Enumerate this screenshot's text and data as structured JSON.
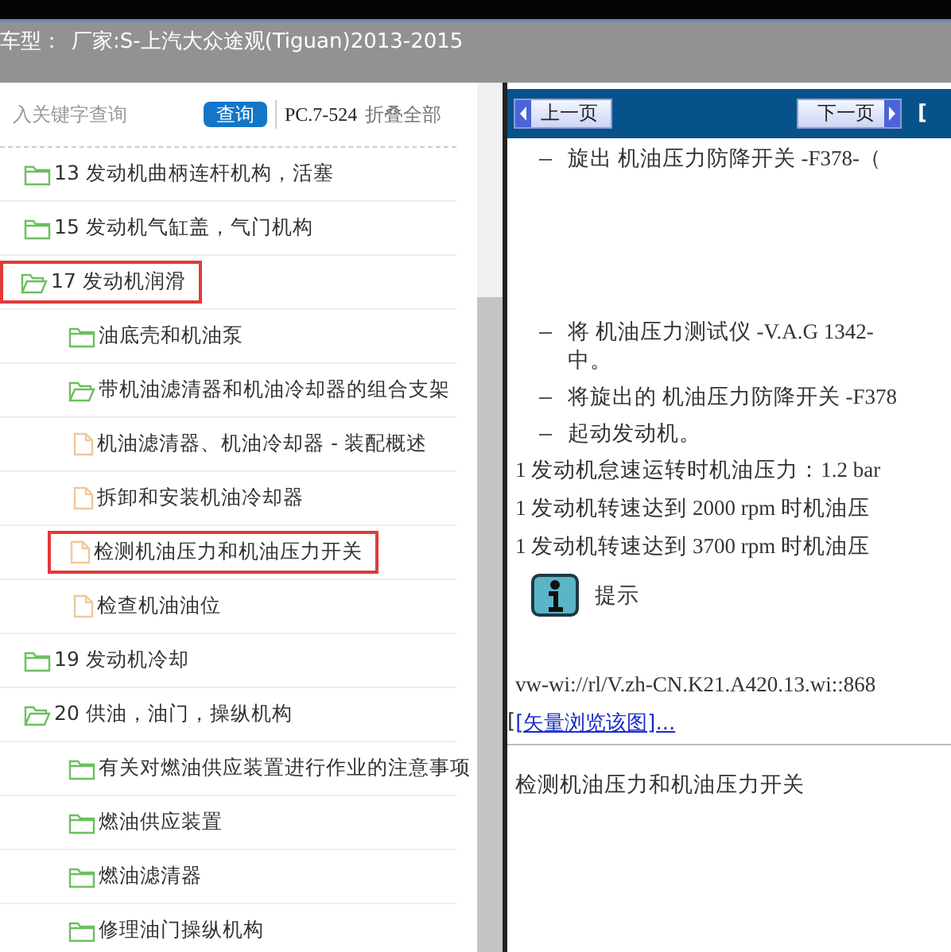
{
  "header": {
    "label": "车型：",
    "value": "厂家:S-上汽大众途观(Tiguan)2013-2015"
  },
  "search": {
    "placeholder": "入关键字查询",
    "button": "查询",
    "code": "PC.7-524",
    "collapse": "折叠全部"
  },
  "tree": [
    {
      "kind": "folder",
      "label": "13 发动机曲柄连杆机构，活塞",
      "expanded": false,
      "highlighted": false
    },
    {
      "kind": "folder",
      "label": "15 发动机气缸盖，气门机构",
      "expanded": false,
      "highlighted": false
    },
    {
      "kind": "folder",
      "label": "17 发动机润滑",
      "expanded": true,
      "highlighted": true,
      "children": [
        {
          "kind": "folder",
          "label": "油底壳和机油泵",
          "expanded": false,
          "highlighted": false
        },
        {
          "kind": "folder",
          "label": "带机油滤清器和机油冷却器的组合支架",
          "expanded": true,
          "highlighted": false
        },
        {
          "kind": "document",
          "label": "机油滤清器、机油冷却器 - 装配概述",
          "highlighted": false
        },
        {
          "kind": "document",
          "label": "拆卸和安装机油冷却器",
          "highlighted": false
        },
        {
          "kind": "document",
          "label": "检测机油压力和机油压力开关",
          "highlighted": true
        },
        {
          "kind": "document",
          "label": "检查机油油位",
          "highlighted": false
        }
      ]
    },
    {
      "kind": "folder",
      "label": "19 发动机冷却",
      "expanded": false,
      "highlighted": false
    },
    {
      "kind": "folder",
      "label": "20 供油，油门，操纵机构",
      "expanded": true,
      "highlighted": false,
      "children": [
        {
          "kind": "folder",
          "label": "有关对燃油供应装置进行作业的注意事项",
          "expanded": false,
          "highlighted": false
        },
        {
          "kind": "folder",
          "label": "燃油供应装置",
          "expanded": false,
          "highlighted": false
        },
        {
          "kind": "folder",
          "label": "燃油滤清器",
          "expanded": false,
          "highlighted": false
        },
        {
          "kind": "folder",
          "label": "修理油门操纵机构",
          "expanded": false,
          "highlighted": false
        }
      ]
    }
  ],
  "nav": {
    "prev": "上一页",
    "next": "下一页",
    "link": "["
  },
  "content": [
    {
      "kind": "step",
      "text": "旋出 机油压力防降开关 -F378-（"
    },
    {
      "kind": "gap"
    },
    {
      "kind": "step",
      "text": "将 机油压力测试仪 -V.A.G 1342-",
      "cont": "中。"
    },
    {
      "kind": "step",
      "text": "将旋出的 机油压力防降开关 -F378"
    },
    {
      "kind": "step",
      "text": "起动发动机。"
    },
    {
      "kind": "item",
      "text": "1 发动机怠速运转时机油压力：1.2 bar"
    },
    {
      "kind": "item",
      "text": "1 发动机转速达到 2000 rpm 时机油压"
    },
    {
      "kind": "item",
      "text": "1 发动机转速达到 3700 rpm 时机油压"
    },
    {
      "kind": "note",
      "text": "提示"
    },
    {
      "kind": "url",
      "text": "vw-wi://rl/V.zh-CN.K21.A420.13.wi::868"
    },
    {
      "kind": "link",
      "prefix": "[",
      "text": "[矢量浏览该图]..."
    },
    {
      "kind": "heading",
      "text": "检测机油压力和机油压力开关"
    }
  ]
}
